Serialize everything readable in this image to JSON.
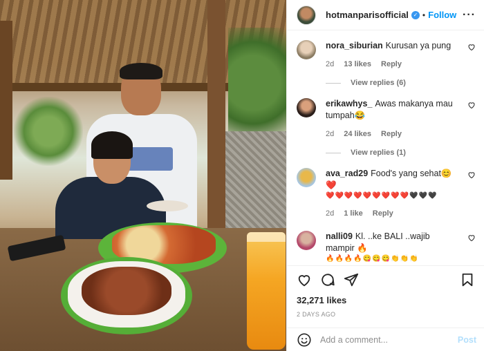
{
  "header": {
    "username": "hotmanparisofficial",
    "separator": "•",
    "follow_label": "Follow",
    "more_label": "···"
  },
  "comments": [
    {
      "username": "nora_siburian",
      "text": "Kurusan ya pung",
      "age": "2d",
      "likes": "13 likes",
      "reply_label": "Reply",
      "view_replies": "View replies (6)"
    },
    {
      "username": "erikawhys_",
      "text": "Awas makanya mau tumpah😂",
      "age": "2d",
      "likes": "24 likes",
      "reply_label": "Reply",
      "view_replies": "View replies (1)"
    },
    {
      "username": "ava_rad29",
      "text": "Food's yang sehat😊❤️",
      "emoji_line": "❤️❤️❤️❤️❤️❤️❤️❤️❤️🖤🖤🖤",
      "age": "2d",
      "likes": "1 like",
      "reply_label": "Reply"
    },
    {
      "username": "nalli09",
      "text": "Kl. ..ke BALI ..wajib mampir 🔥",
      "emoji_line": "🔥🔥🔥🔥😋😋😋👏👏👏"
    }
  ],
  "actions": {
    "likes_count": "32,271 likes",
    "date": "2 DAYS AGO"
  },
  "composer": {
    "placeholder": "Add a comment...",
    "post_label": "Post"
  },
  "colors": {
    "accent": "#0095f6",
    "post_disabled": "#b2dffc",
    "verified": "#3897f0"
  }
}
